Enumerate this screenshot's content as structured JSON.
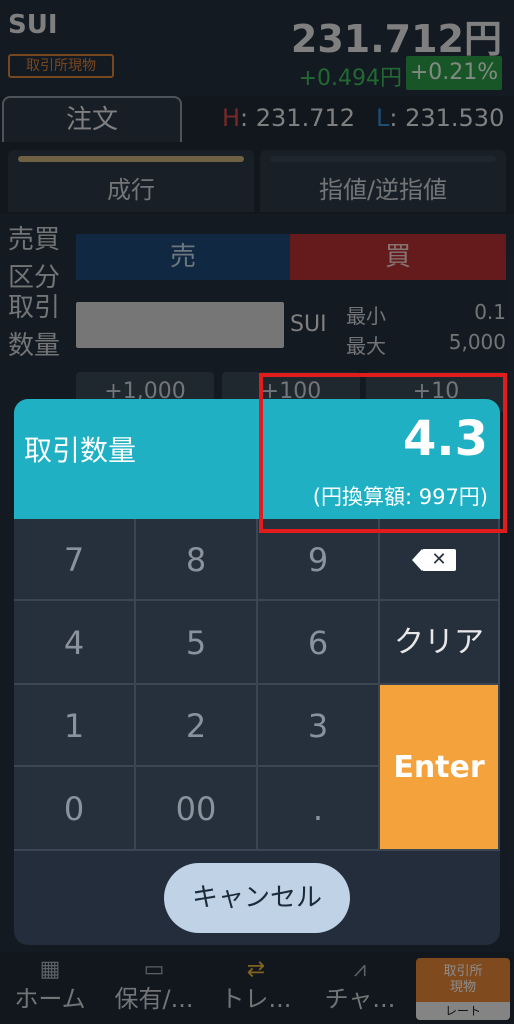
{
  "header": {
    "symbol": "SUI",
    "market_badge": "取引所現物",
    "price": "231.712円",
    "change": "+0.494円",
    "change_pct": "+0.21%"
  },
  "tabs": {
    "order_tab": "注文",
    "high_label": "H",
    "high_value": ": 231.712",
    "low_label": "L",
    "low_value": ": 231.530"
  },
  "order_types": {
    "market": "成行",
    "limit": "指値/逆指値"
  },
  "form": {
    "side_label_1": "売買",
    "side_label_2": "区分",
    "sell": "売",
    "buy": "買",
    "qty_label_1": "取引",
    "qty_label_2": "数量",
    "unit": "SUI",
    "min_label": "最小",
    "min_value": "0.1",
    "max_label": "最大",
    "max_value": "5,000",
    "inc1": "+1,000",
    "inc2": "+100",
    "inc3": "+10"
  },
  "dialog": {
    "title": "取引数量",
    "value": "4.3",
    "yen_equiv": "(円換算額: 997円)",
    "keys": [
      "7",
      "8",
      "9",
      "4",
      "5",
      "6",
      "1",
      "2",
      "3",
      "0",
      "00",
      "."
    ],
    "backspace_glyph": "✕",
    "clear": "クリア",
    "enter": "Enter",
    "cancel": "キャンセル"
  },
  "bottom_nav": {
    "home": "ホーム",
    "holdings": "保有/...",
    "trade": "トレ...",
    "chart": "チャ...",
    "rate_top": "取引所\n現物",
    "rate_bottom": "レート"
  },
  "colors": {
    "dialog_header": "#1fb0c4",
    "enter_key": "#f4a23b",
    "highlight_box": "#e01c1c",
    "buy": "#b83232",
    "sell": "#1f4a78"
  }
}
